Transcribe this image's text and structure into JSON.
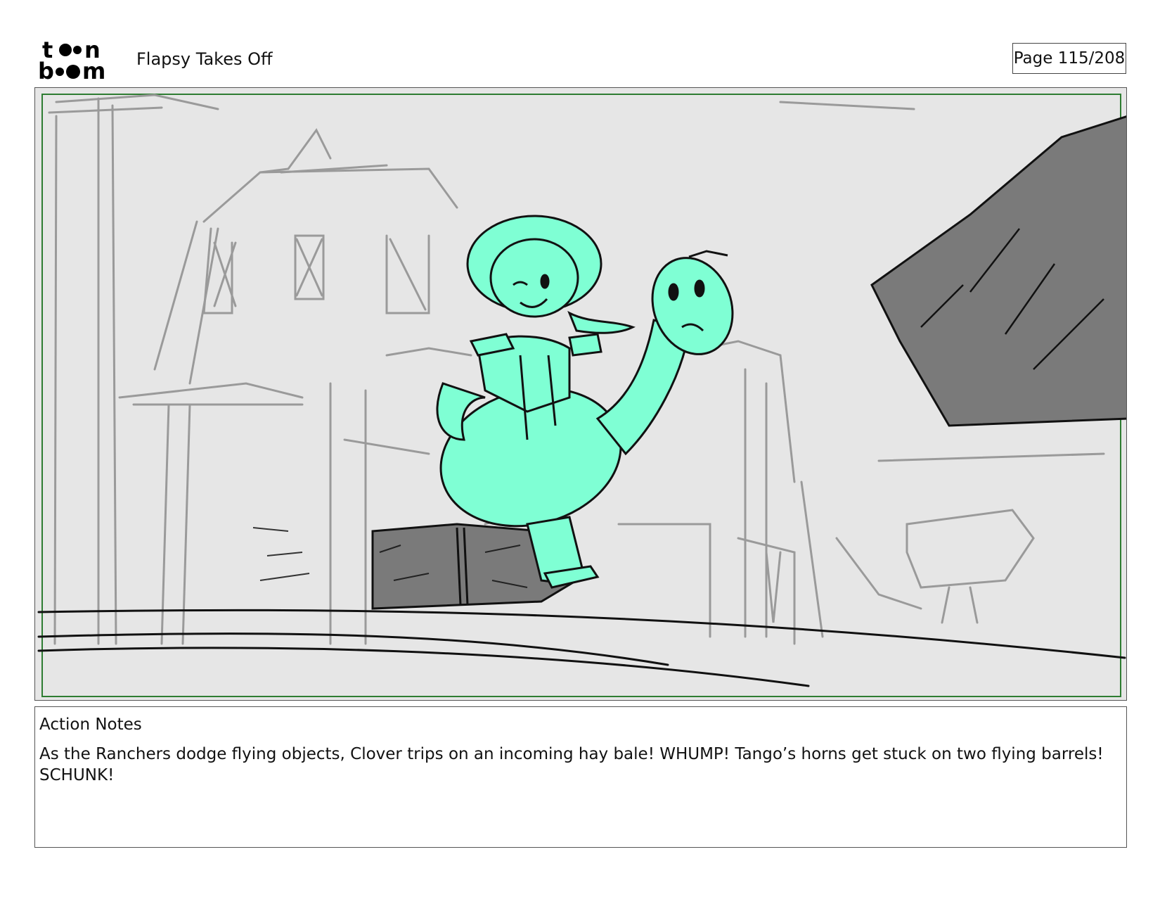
{
  "header": {
    "logo": {
      "line1": "t",
      "line1b": "n",
      "line2": "b",
      "line2b": "m"
    },
    "title": "Flapsy Takes Off",
    "page": "Page 115/208"
  },
  "panel": {
    "background_color": "#e6e6e6",
    "safe_area_color": "#2e7d32",
    "character_fill": "#7fffd4",
    "prop_fill": "#7a7a7a"
  },
  "notes": {
    "heading": "Action Notes",
    "text": "As the Ranchers dodge flying objects, Clover trips on an incoming hay bale! WHUMP! Tango’s horns get stuck on two flying barrels! SCHUNK!"
  }
}
